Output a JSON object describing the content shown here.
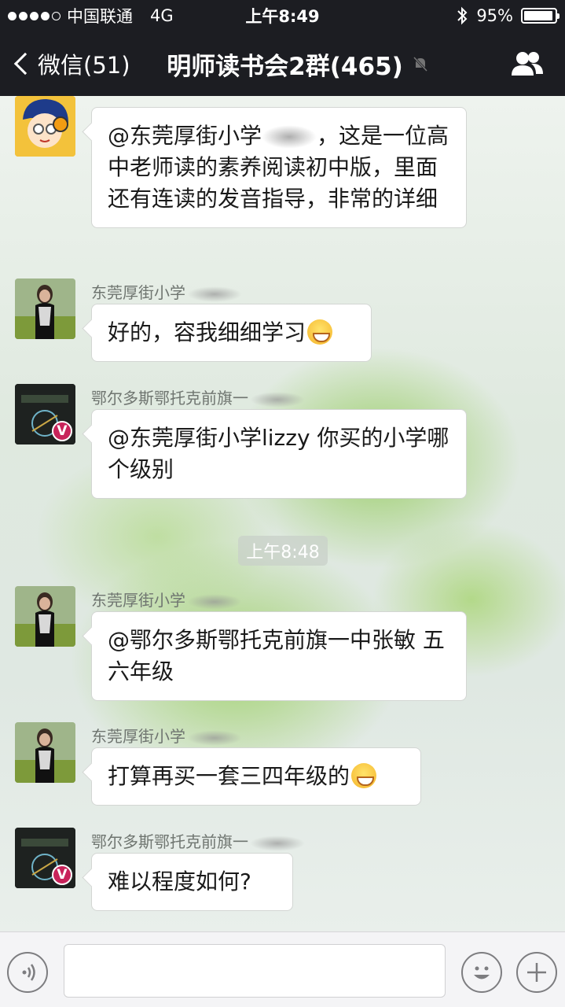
{
  "status_bar": {
    "carrier": "中国联通",
    "network": "4G",
    "time": "上午8:49",
    "battery": "95%",
    "battery_level": 0.95
  },
  "nav": {
    "back_label": "微信(51)",
    "title": "明师读书会2群(465)"
  },
  "messages": [
    {
      "sender": "",
      "text": "@东莞厚街小学",
      "text_cont": "，这是一位高中老师读的素养阅读初中版，里面还有连读的发音指导，非常的详细"
    },
    {
      "sender": "东莞厚街小学",
      "text": "好的，容我细细学习"
    },
    {
      "sender": "鄂尔多斯鄂托克前旗一",
      "text": "@东莞厚街小学lizzy 你买的小学哪个级别"
    },
    {
      "sender": "东莞厚街小学",
      "text": "@鄂尔多斯鄂托克前旗一中张敏 五六年级"
    },
    {
      "sender": "东莞厚街小学",
      "text": "打算再买一套三四年级的"
    },
    {
      "sender": "鄂尔多斯鄂托克前旗一",
      "text": "难以程度如何?"
    }
  ],
  "time_divider": "上午8:48",
  "input_bar": {
    "placeholder": ""
  },
  "icons": {
    "back": "chevron-left-icon",
    "mute": "bell-off-icon",
    "group": "group-members-icon",
    "voice": "voice-icon",
    "emoji": "emoji-icon",
    "plus": "plus-icon",
    "v_badge": "V"
  }
}
